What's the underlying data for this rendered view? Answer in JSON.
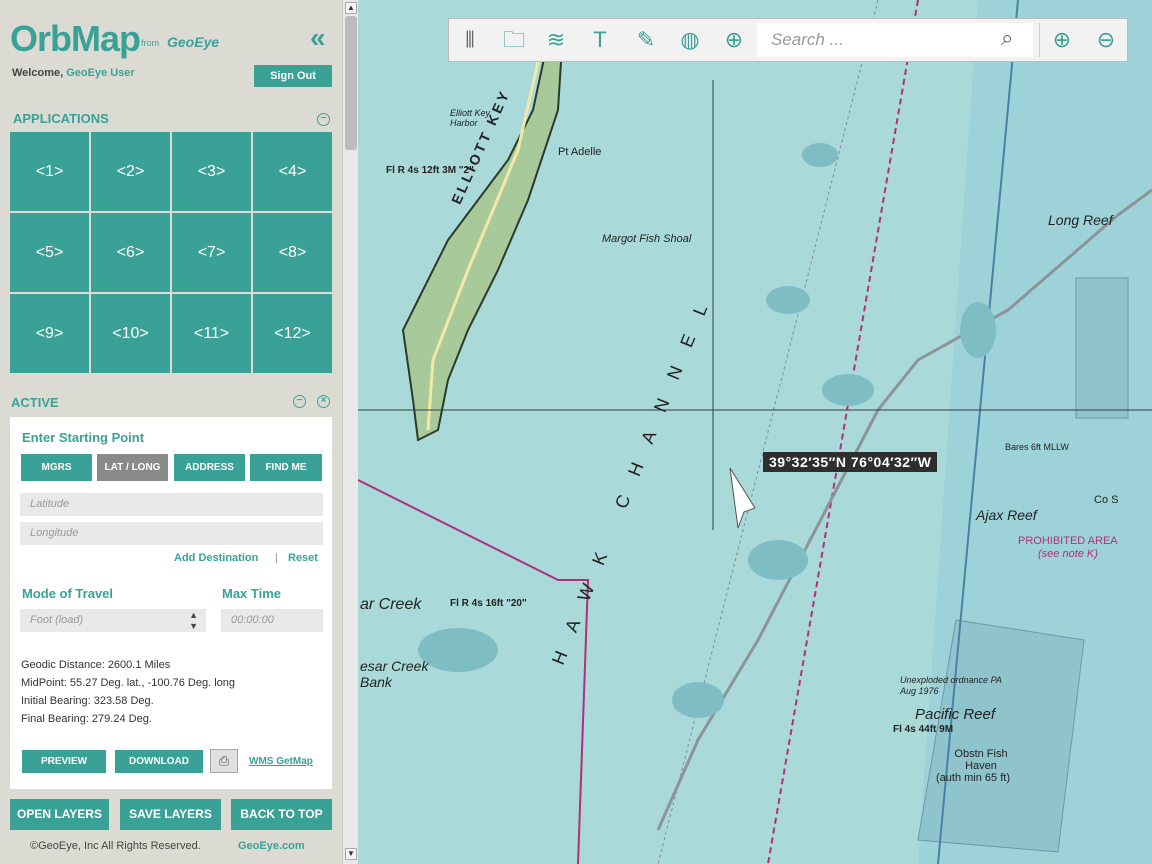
{
  "app": {
    "name": "OrbMap",
    "from_text": "from",
    "brand": "GeoEye"
  },
  "header": {
    "welcome_prefix": "Welcome,",
    "user_name": "GeoEye User",
    "sign_out_label": "Sign Out"
  },
  "applications": {
    "title": "APPLICATIONS",
    "tiles": [
      "<1>",
      "<2>",
      "<3>",
      "<4>",
      "<5>",
      "<6>",
      "<7>",
      "<8>",
      "<9>",
      "<10>",
      "<11>",
      "<12>"
    ]
  },
  "active": {
    "title": "ACTIVE",
    "enter_start_label": "Enter Starting Point",
    "modes": [
      "MGRS",
      "LAT / LONG",
      "ADDRESS",
      "FIND ME"
    ],
    "selected_mode": "LAT / LONG",
    "latitude_placeholder": "Latitude",
    "longitude_placeholder": "Longitude",
    "add_destination_label": "Add Destination",
    "separator": "|",
    "reset_label": "Reset",
    "mode_of_travel_label": "Mode of Travel",
    "mode_of_travel_value": "Foot (load)",
    "max_time_label": "Max Time",
    "max_time_placeholder": "00:00:00",
    "geodesic_distance": "Geodic Distance: 2600.1 Miles",
    "midpoint": "MidPoint: 55.27 Deg. lat., -100.76 Deg. long",
    "initial_bearing": "Initial Bearing: 323.58 Deg.",
    "final_bearing": "Final Bearing: 279.24 Deg.",
    "preview_label": "PREVIEW",
    "download_label": "DOWNLOAD",
    "wms_label": "WMS GetMap"
  },
  "footer_buttons": {
    "open_layers": "OPEN LAYERS",
    "save_layers": "SAVE LAYERS",
    "back_to_top": "BACK TO TOP"
  },
  "footer": {
    "copyright": "©GeoEye, Inc  All Rights Reserved.",
    "link": "GeoEye.com"
  },
  "toolbar": {
    "search_placeholder": "Search ...",
    "icons": [
      "grip-icon",
      "folder-icon",
      "layers-icon",
      "text-icon",
      "pencil-icon",
      "globe-icon",
      "add-pin-icon"
    ]
  },
  "map": {
    "coordinate_readout": "39°32′35″N  76°04′32″W",
    "labels": {
      "elliott_key": "ELLIOTT KEY",
      "elliott_harbor": "Elliott Key Harbor",
      "pt_adelle": "Pt Adelle",
      "margot_shoal": "Margot Fish Shoal",
      "long_reef": "Long Reef",
      "ajax_reef": "Ajax Reef",
      "prohibited": "PROHIBITED AREA",
      "prohibited_note": "(see note K)",
      "pacific_reef": "Pacific Reef",
      "pacific_light": "Fl 4s 44ft 9M",
      "obstn_haven": "Obstn Fish Haven",
      "obstn_haven_sub": "(auth min 65 ft)",
      "caesar_creek": "ar Creek",
      "caesar_bank": "esar Creek Bank",
      "hawk_channel": "HAWK CHANNEL",
      "light_r20": "Fl R 4s 16ft \"20\"",
      "light_r2": "Fl R 4s 12ft 3M \"2\"",
      "ordnance": "Unexploded ordnance PA",
      "ordnance_date": "Aug 1976",
      "bares": "Bares 6ft MLLW",
      "cos": "Co S"
    },
    "accent": "#3aa197",
    "land_color": "#a8c99a",
    "water_color": "#a9d9d9",
    "magenta": "#b0307f"
  }
}
